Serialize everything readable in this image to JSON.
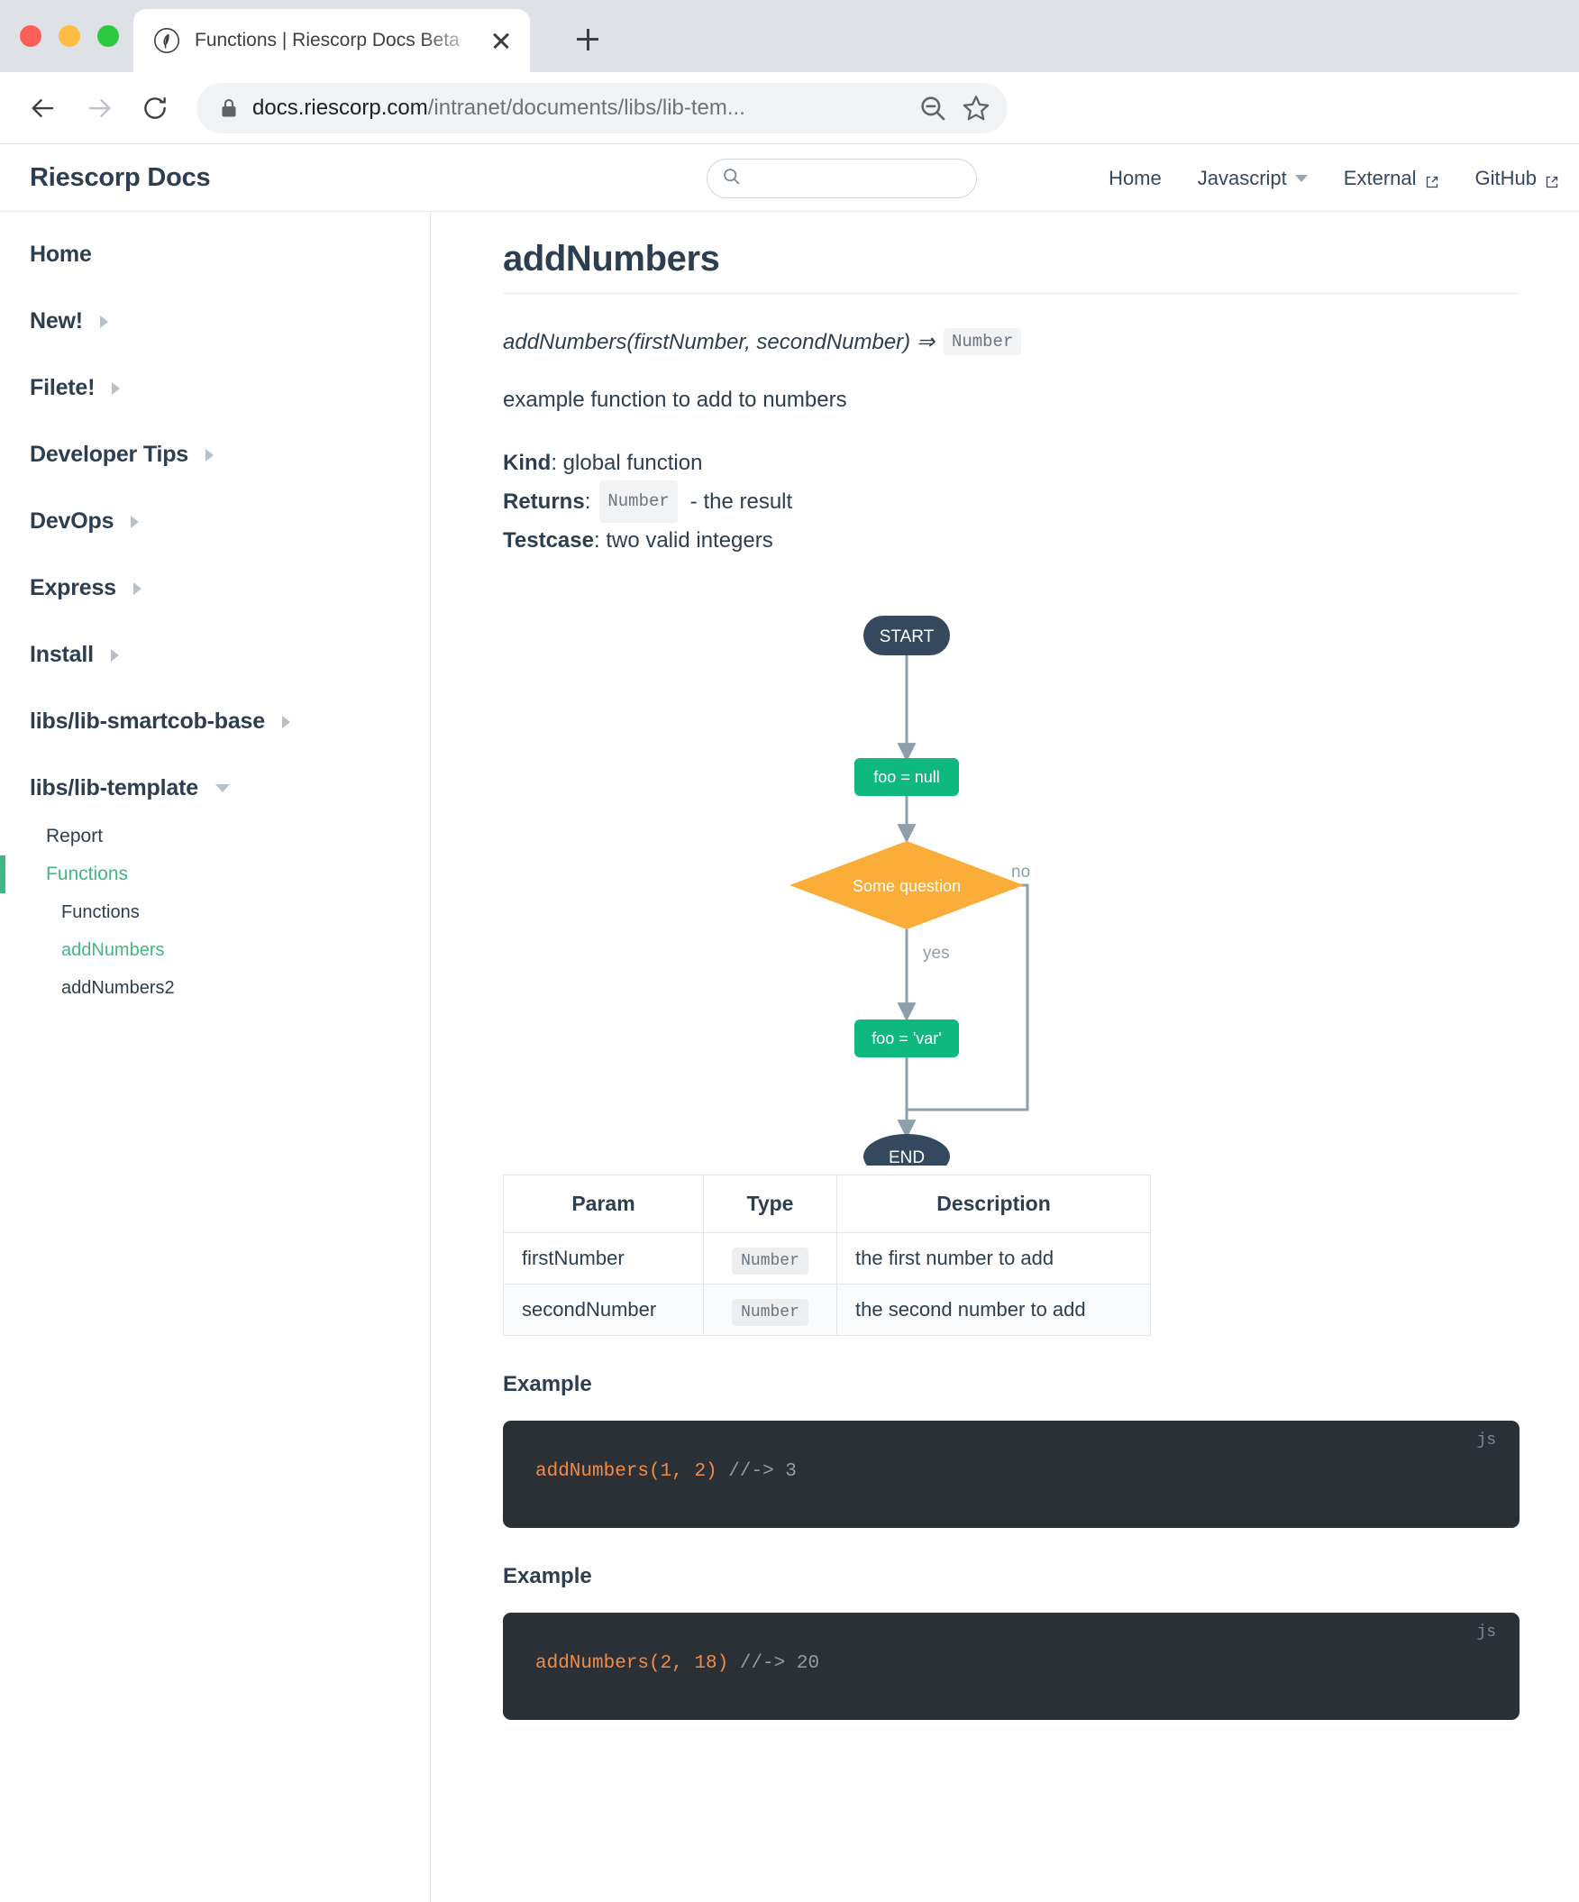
{
  "browser": {
    "tab_title": "Functions | Riescorp Docs Beta",
    "favicon_icon": "feather-circle-icon",
    "close_icon": "close-icon",
    "newtab_icon": "plus-icon",
    "back_icon": "arrow-left-icon",
    "forward_icon": "arrow-right-icon",
    "reload_icon": "reload-icon",
    "lock_icon": "lock-icon",
    "url_host": "docs.riescorp.com",
    "url_path": "/intranet/documents/libs/lib-tem...",
    "zoom_icon": "zoom-out-icon",
    "bookmark_icon": "star-icon"
  },
  "header": {
    "brand": "Riescorp Docs",
    "search": {
      "value": "",
      "placeholder": "",
      "icon": "search-icon"
    },
    "nav": [
      {
        "label": "Home",
        "dropdown": false,
        "external": false
      },
      {
        "label": "Javascript",
        "dropdown": true,
        "external": false
      },
      {
        "label": "External",
        "dropdown": false,
        "external": true
      },
      {
        "label": "GitHub",
        "dropdown": false,
        "external": true
      }
    ]
  },
  "sidebar": {
    "top_items": [
      {
        "label": "Home",
        "caret": "none"
      },
      {
        "label": "New!",
        "caret": "right"
      },
      {
        "label": "Filete!",
        "caret": "right"
      },
      {
        "label": "Developer Tips",
        "caret": "right"
      },
      {
        "label": "DevOps",
        "caret": "right"
      },
      {
        "label": "Express",
        "caret": "right"
      },
      {
        "label": "Install",
        "caret": "right"
      },
      {
        "label": "libs/lib-smartcob-base",
        "caret": "right"
      },
      {
        "label": "libs/lib-template",
        "caret": "down"
      }
    ],
    "sub_items": [
      {
        "label": "Report",
        "active": false
      },
      {
        "label": "Functions",
        "active": true
      }
    ],
    "sub2_items": [
      {
        "label": "Functions",
        "active": false
      },
      {
        "label": "addNumbers",
        "active": true
      },
      {
        "label": "addNumbers2",
        "active": false
      }
    ]
  },
  "main": {
    "title": "addNumbers",
    "signature": "addNumbers(firstNumber, secondNumber) ⇒",
    "signature_return_type": "Number",
    "description": "example function to add to numbers",
    "kind_label": "Kind",
    "kind_value": "global function",
    "returns_label": "Returns",
    "returns_type": "Number",
    "returns_desc": "- the result",
    "testcase_label": "Testcase",
    "testcase_value": "two valid integers"
  },
  "chart_data": {
    "type": "diagram",
    "subtype": "flowchart",
    "title": "",
    "nodes": [
      {
        "id": "start",
        "label": "START",
        "shape": "stadium",
        "color": "#34495e",
        "text_color": "#ffffff"
      },
      {
        "id": "n1",
        "label": "foo = null",
        "shape": "rounded-rect",
        "color": "#0fb87e",
        "text_color": "#ffffff"
      },
      {
        "id": "q1",
        "label": "Some question",
        "shape": "diamond",
        "color": "#fbad3a",
        "text_color": "#ffffff"
      },
      {
        "id": "n2",
        "label": "foo = 'var'",
        "shape": "rounded-rect",
        "color": "#0fb87e",
        "text_color": "#ffffff"
      },
      {
        "id": "end",
        "label": "END",
        "shape": "stadium",
        "color": "#34495e",
        "text_color": "#ffffff"
      }
    ],
    "edges": [
      {
        "from": "start",
        "to": "n1",
        "label": ""
      },
      {
        "from": "n1",
        "to": "q1",
        "label": ""
      },
      {
        "from": "q1",
        "to": "n2",
        "label": "yes"
      },
      {
        "from": "q1",
        "to": "end",
        "label": "no"
      },
      {
        "from": "n2",
        "to": "end",
        "label": ""
      }
    ],
    "edge_color": "#8d9fab",
    "labels": {
      "yes": "yes",
      "no": "no"
    }
  },
  "params_table": {
    "headers": [
      "Param",
      "Type",
      "Description"
    ],
    "rows": [
      {
        "param": "firstNumber",
        "type": "Number",
        "description": "the first number to add"
      },
      {
        "param": "secondNumber",
        "type": "Number",
        "description": "the second number to add"
      }
    ]
  },
  "examples": [
    {
      "label": "Example",
      "lang": "js",
      "fn": "addNumbers",
      "args": "(1, 2)",
      "arg1": "1",
      "arg2": "2",
      "comment": "//-> 3",
      "code": "addNumbers(1, 2) //-> 3"
    },
    {
      "label": "Example",
      "lang": "js",
      "fn": "addNumbers",
      "args": "(2, 18)",
      "arg1": "2",
      "arg2": "18",
      "comment": "//-> 20",
      "code": "addNumbers(2, 18) //-> 20"
    }
  ],
  "colors": {
    "accent_green": "#41b883",
    "node_green": "#0fb87e",
    "node_dark": "#34495e",
    "node_orange": "#fbad3a",
    "edge_gray": "#8d9fab",
    "text_dark": "#2c3e50",
    "code_bg": "#2b2f36",
    "code_orange": "#f08d49"
  }
}
